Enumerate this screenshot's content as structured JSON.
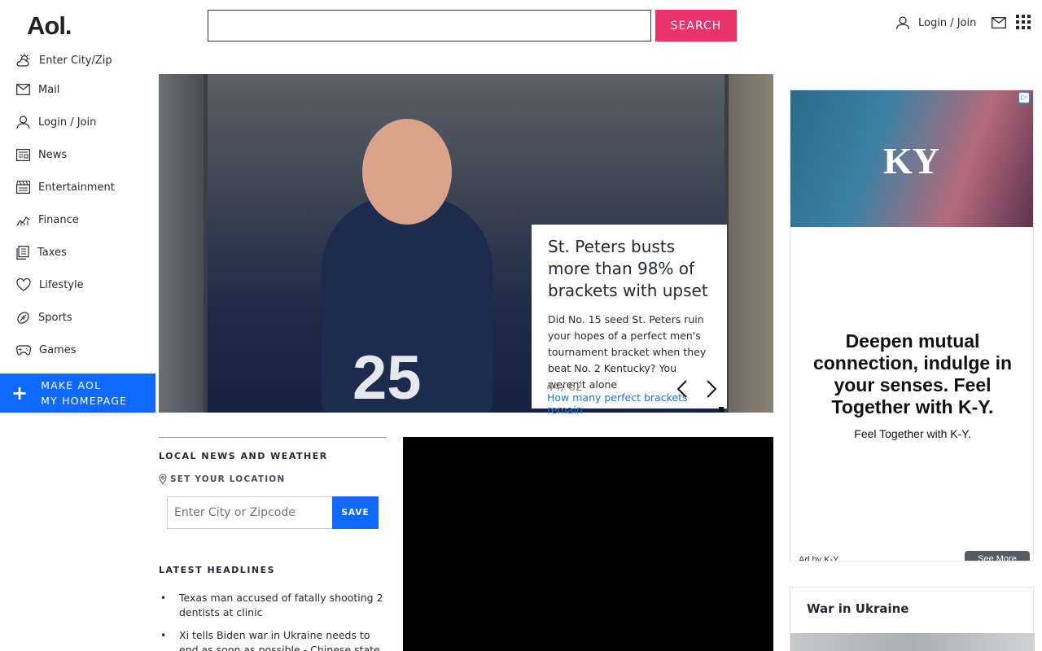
{
  "header": {
    "logo": "Aol.",
    "search_value": "",
    "search_button": "SEARCH",
    "login": "Login / Join"
  },
  "sidebar": {
    "items": [
      {
        "label": "Enter City/Zip",
        "icon": "weather-icon"
      },
      {
        "label": "Mail",
        "icon": "mail-icon"
      },
      {
        "label": "Login / Join",
        "icon": "user-icon"
      },
      {
        "label": "News",
        "icon": "news-icon"
      },
      {
        "label": "Entertainment",
        "icon": "clapper-icon"
      },
      {
        "label": "Finance",
        "icon": "chart-icon"
      },
      {
        "label": "Taxes",
        "icon": "document-icon"
      },
      {
        "label": "Lifestyle",
        "icon": "heart-icon"
      },
      {
        "label": "Sports",
        "icon": "ball-icon"
      },
      {
        "label": "Games",
        "icon": "gamepad-icon"
      }
    ],
    "homepage_line1": "MAKE AOL",
    "homepage_line2": "MY HOMEPAGE"
  },
  "hero": {
    "title": "St. Peters busts more than 98% of brackets with upset",
    "description": "Did No. 15 seed St. Peters ruin your hopes of a perfect men's tournament bracket when they beat No. 2 Kentucky? You weren't alone",
    "counter": "44/ 62",
    "link": "How many perfect brackets remain",
    "jersey_number": "25"
  },
  "local": {
    "heading": "LOCAL NEWS AND WEATHER",
    "set_location": "SET YOUR LOCATION",
    "input_placeholder": "Enter City or Zipcode",
    "save_button": "SAVE"
  },
  "headlines": {
    "heading": "LATEST HEADLINES",
    "items": [
      "Texas man accused of fatally shooting 2 dentists at clinic",
      "Xi tells Biden war in Ukraine needs to end as soon as possible - Chinese state media"
    ]
  },
  "ad": {
    "logo": "KY",
    "headline": "Deepen mutual connection, indulge in your senses. Feel Together with K-Y.",
    "subtext": "Feel Together with K-Y.",
    "by": "Ad by K-Y",
    "see_more": "See More"
  },
  "ukraine": {
    "title": "War in Ukraine"
  },
  "colors": {
    "search_button": "#e8336b",
    "primary_blue": "#0f69ff",
    "link": "#1a73e8"
  }
}
